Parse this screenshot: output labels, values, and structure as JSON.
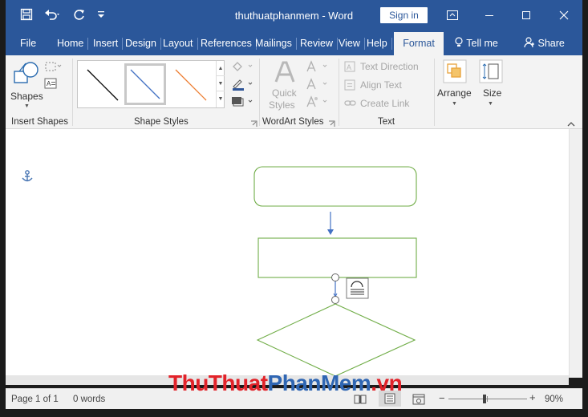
{
  "app": {
    "doc_name": "thuthuatphanmem",
    "separator": "-",
    "app_name": "Word",
    "sign_in": "Sign in"
  },
  "tabs": [
    "File",
    "Home",
    "Insert",
    "Design",
    "Layout",
    "References",
    "Mailings",
    "Review",
    "View",
    "Help",
    "Format"
  ],
  "tell_me": "Tell me",
  "share": "Share",
  "ribbon": {
    "shapes": "Shapes",
    "insert_shapes": "Insert Shapes",
    "shape_styles": "Shape Styles",
    "quick_styles_1": "Quick",
    "quick_styles_2": "Styles",
    "wordart_styles": "WordArt Styles",
    "text_direction": "Text Direction",
    "align_text": "Align Text",
    "create_link": "Create Link",
    "text_group": "Text",
    "arrange": "Arrange",
    "size": "Size"
  },
  "status": {
    "page": "Page 1 of 1",
    "words": "0 words",
    "zoom": "90%"
  },
  "watermark": {
    "part1": "ThuThuat",
    "part2": "PhanMem",
    "part3": ".vn"
  },
  "colors": {
    "accent": "#2b579a",
    "shape_stroke": "#70ad47",
    "connector": "#4472c4",
    "orange_line": "#ed7d31"
  }
}
